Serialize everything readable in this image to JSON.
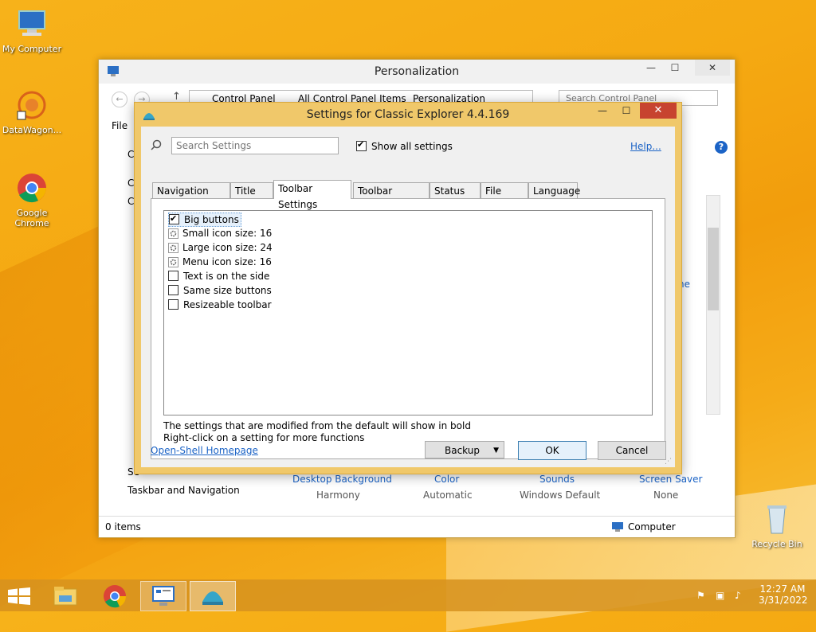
{
  "desktop": {
    "icons": [
      {
        "label": "My Computer",
        "icon": "computer-icon"
      },
      {
        "label": "DataWagon...",
        "icon": "datawagon-icon"
      },
      {
        "label": "Google Chrome",
        "icon": "chrome-icon"
      },
      {
        "label": "Recycle Bin",
        "icon": "recycle-bin-icon"
      }
    ]
  },
  "explorer": {
    "title": "Personalization",
    "breadcrumb": [
      "Control Panel",
      "All Control Panel Items",
      "Personalization"
    ],
    "search_placeholder": "Search Control Panel",
    "menu_file": "File",
    "behind_text": {
      "left_c1": "C",
      "left_c2": "C",
      "left_c3": "C",
      "right_ne": "ne",
      "see_also": "Se",
      "taskbar_nav": "Taskbar and Navigation"
    },
    "bottom_items": [
      {
        "label": "Desktop Background",
        "value": "Harmony"
      },
      {
        "label": "Color",
        "value": "Automatic"
      },
      {
        "label": "Sounds",
        "value": "Windows Default"
      },
      {
        "label": "Screen Saver",
        "value": "None"
      }
    ],
    "status_items": "0 items",
    "status_computer": "Computer"
  },
  "dialog": {
    "title": "Settings for Classic Explorer 4.4.169",
    "search_placeholder": "Search Settings",
    "show_all_label": "Show all settings",
    "help_link": "Help...",
    "tabs": [
      "Navigation Pane",
      "Title Bar",
      "Toolbar Settings",
      "Toolbar Buttons",
      "Status Bar",
      "File Pane",
      "Language"
    ],
    "active_tab": "Toolbar Settings",
    "settings": [
      {
        "label": "Big buttons",
        "kind": "checkbox",
        "checked": true
      },
      {
        "label": "Small icon size: 16",
        "kind": "value"
      },
      {
        "label": "Large icon size: 24",
        "kind": "value"
      },
      {
        "label": "Menu icon size: 16",
        "kind": "value"
      },
      {
        "label": "Text is on the side",
        "kind": "checkbox",
        "checked": false
      },
      {
        "label": "Same size buttons",
        "kind": "checkbox",
        "checked": false
      },
      {
        "label": "Resizeable toolbar",
        "kind": "checkbox",
        "checked": false
      }
    ],
    "hint1": "The settings that are modified from the default will show in bold",
    "hint2": "Right-click on a setting for more functions",
    "homepage_link": "Open-Shell Homepage",
    "backup_label": "Backup",
    "ok_label": "OK",
    "cancel_label": "Cancel"
  },
  "taskbar": {
    "time": "12:27 AM",
    "date": "3/31/2022"
  }
}
